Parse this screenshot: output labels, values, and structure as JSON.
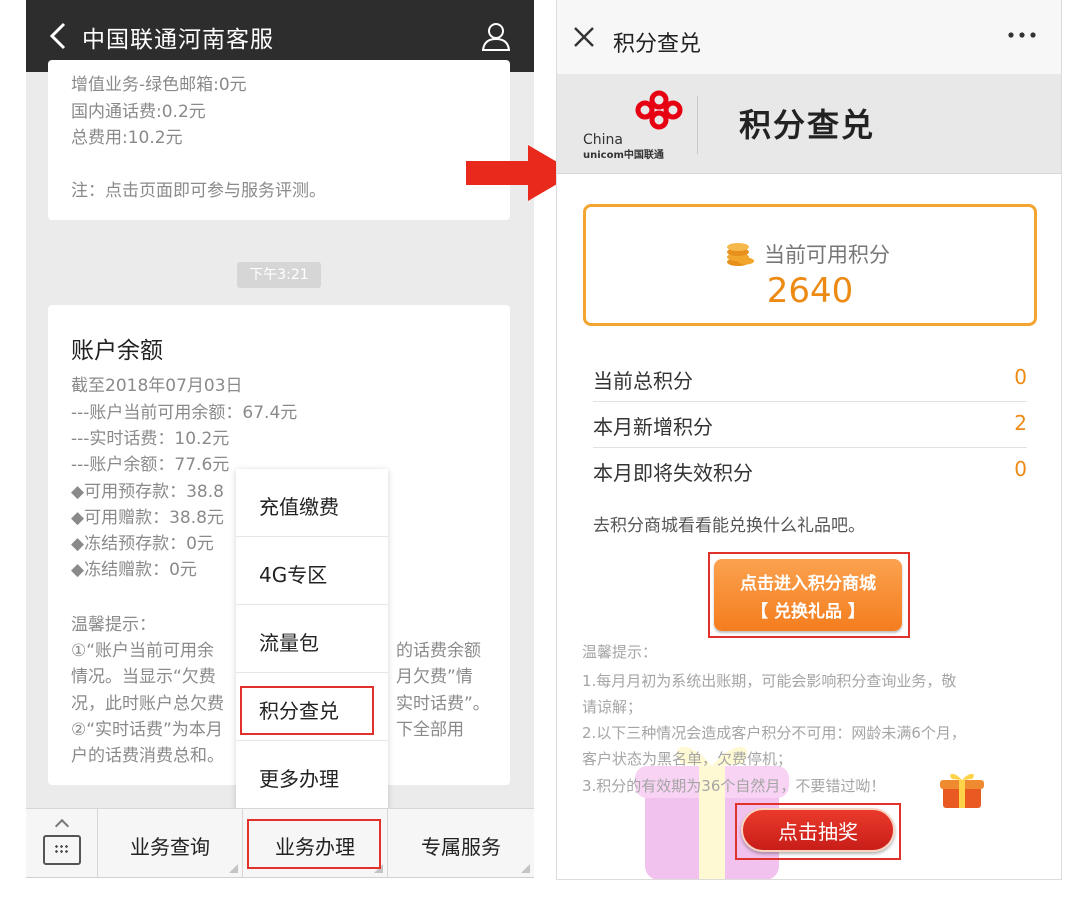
{
  "left_screen": {
    "header": {
      "title": "中国联通河南客服",
      "back_icon": "chevron-left-icon",
      "user_icon": "user-icon"
    },
    "bill_card": {
      "lines": [
        "增值业务-绿色邮箱:0元",
        "国内通话费:0.2元",
        "总费用:10.2元",
        "注：点击页面即可参与服务评测。"
      ]
    },
    "timestamp": "下午3:21",
    "balance_card": {
      "title": "账户余额",
      "lines": [
        "截至2018年07月03日",
        "---账户当前可用余额：67.4元",
        "---实时话费：10.2元",
        "---账户余额：77.6元",
        "◆可用预存款：38.8",
        "◆可用赠款：38.8元",
        "◆冻结预存款：0元",
        "◆冻结赠款：0元",
        "温馨提示：",
        "①“账户当前可用余",
        "情况。当显示“欠费",
        "况，此时账户总欠费",
        "②“实时话费”为本月",
        "户的话费消费总和。"
      ],
      "right_fragments": [
        "的话费余额",
        "月欠费”情",
        "实时话费”。",
        "下全部用"
      ]
    },
    "popup_menu": {
      "items": [
        "充值缴费",
        "4G专区",
        "流量包",
        "积分查兑",
        "更多办理"
      ],
      "highlighted": "积分查兑"
    },
    "bottom_bar": {
      "keyboard_icon": "keyboard-icon",
      "tabs": [
        "业务查询",
        "业务办理",
        "专属服务"
      ],
      "highlighted": "业务办理"
    }
  },
  "right_screen": {
    "header": {
      "title": "积分查兑",
      "close_icon": "close-icon",
      "more_icon": "more-dots-icon"
    },
    "banner": {
      "logo_text_1": "China",
      "logo_text_2": "unicom中国联通",
      "title": "积分查兑"
    },
    "available_points": {
      "label": "当前可用积分",
      "value": "2640",
      "icon": "coins-icon"
    },
    "points_rows": [
      {
        "label": "当前总积分",
        "value": "0"
      },
      {
        "label": "本月新增积分",
        "value": "2"
      },
      {
        "label": "本月即将失效积分",
        "value": "0"
      }
    ],
    "mall_hint": "去积分商城看看能兑换什么礼品吧。",
    "mall_button": {
      "line1": "点击进入积分商城",
      "line2": "【 兑换礼品 】"
    },
    "tips": [
      "温馨提示：",
      "1.每月月初为系统出账期，可能会影响积分查询业务，敬",
      "请谅解；",
      "2.以下三种情况会造成客户积分不可用：网龄未满6个月，",
      "客户状态为黑名单，欠费停机；",
      "3.积分的有效期为36个自然月，不要错过呦！"
    ],
    "lottery_button": "点击抽奖",
    "gift_icon": "gift-box-icon"
  },
  "colors": {
    "dark_header": "#2d2d2d",
    "highlight_red": "#e0322b",
    "points_orange": "#ec8a14",
    "box_border": "#f3a431",
    "lottery_red": "#d42a21"
  }
}
